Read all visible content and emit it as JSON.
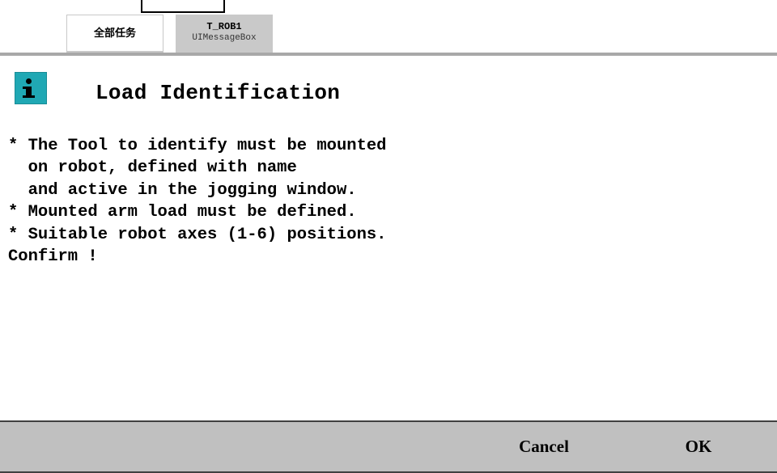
{
  "tabs": {
    "all_tasks": "全部任务",
    "task_name": "T_ROB1",
    "task_module": "UIMessageBox"
  },
  "dialog": {
    "icon": "info-icon",
    "title": "Load Identification",
    "message": "* The Tool to identify must be mounted\n  on robot, defined with name\n  and active in the jogging window.\n* Mounted arm load must be defined.\n* Suitable robot axes (1-6) positions.\nConfirm !"
  },
  "buttons": {
    "cancel": "Cancel",
    "ok": "OK"
  },
  "colors": {
    "icon_bg": "#20a8b4",
    "footer_bg": "#c0c0c0",
    "active_tab_bg": "#c9c9c9"
  }
}
